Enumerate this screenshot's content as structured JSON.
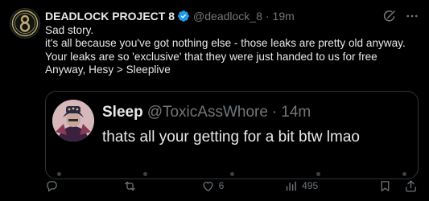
{
  "tweet": {
    "author": {
      "display_name": "DEADLOCK PROJECT 8",
      "handle": "@deadlock_8",
      "avatar_icon": "deadlock-8-logo",
      "verified": true
    },
    "separator": "·",
    "time": "19m",
    "text_lines": [
      "Sad story.",
      "it's all because you've got nothing else - those leaks are pretty old anyway.",
      "Your leaks are so 'exclusive' that they were just handed to us for free",
      "Anyway, Hesy > Sleeplive"
    ],
    "quote": {
      "display_name": "Sleep",
      "handle": "@ToxicAssWhore",
      "separator": "·",
      "time": "14m",
      "text": "thats all your getting for a bit btw lmao"
    },
    "actions": {
      "replies": "",
      "reposts": "",
      "likes": "6",
      "views": "495"
    }
  },
  "colors": {
    "background": "#000000",
    "text_primary": "#e7e9ea",
    "text_secondary": "#71767b",
    "border": "#2f3336",
    "verified_blue": "#1d9bf0",
    "logo_gold": "#c2a66b"
  }
}
